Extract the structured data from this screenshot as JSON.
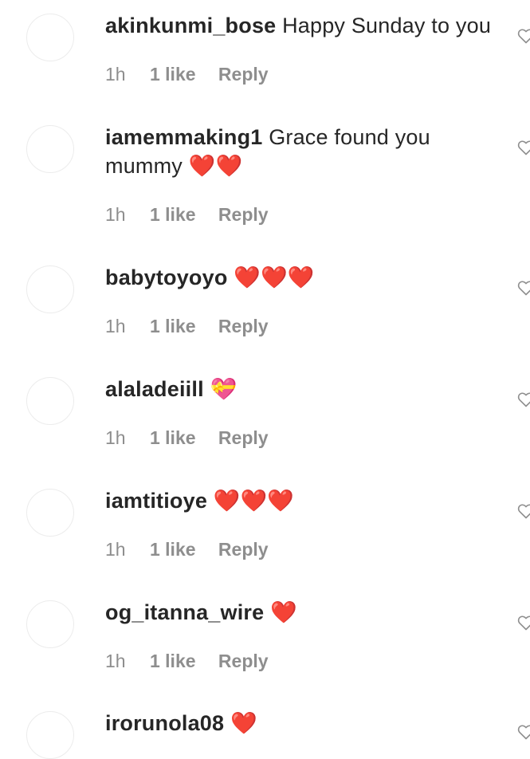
{
  "comments": [
    {
      "username": "akinkunmi_bose",
      "text": "Happy Sunday to you",
      "time": "1h",
      "likes": "1 like",
      "reply": "Reply"
    },
    {
      "username": "iamemmaking1",
      "text": "Grace found you mummy ❤️❤️",
      "time": "1h",
      "likes": "1 like",
      "reply": "Reply"
    },
    {
      "username": "babytoyoyo",
      "text": "❤️❤️❤️",
      "time": "1h",
      "likes": "1 like",
      "reply": "Reply"
    },
    {
      "username": "alaladeiill",
      "text": "💝",
      "time": "1h",
      "likes": "1 like",
      "reply": "Reply"
    },
    {
      "username": "iamtitioye",
      "text": "❤️❤️❤️",
      "time": "1h",
      "likes": "1 like",
      "reply": "Reply"
    },
    {
      "username": "og_itanna_wire",
      "text": "❤️",
      "time": "1h",
      "likes": "1 like",
      "reply": "Reply"
    },
    {
      "username": "irorunola08",
      "text": "❤️",
      "time": "",
      "likes": "",
      "reply": ""
    }
  ],
  "icons": {
    "like": "heart-outline-icon"
  },
  "colors": {
    "text": "#262626",
    "muted": "#8e8e8e",
    "heart": "#e0102c"
  }
}
